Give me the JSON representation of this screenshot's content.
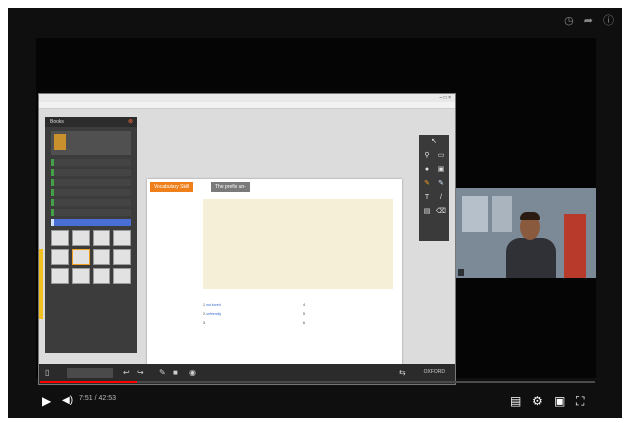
{
  "player": {
    "title": "",
    "top_icons": [
      "clock-icon",
      "share-icon",
      "info-icon"
    ],
    "progress": 0.175,
    "time": "7:51 / 42:53",
    "colors": {
      "progress": "#ff0000",
      "background": "#0f0f0f"
    }
  },
  "window": {
    "title": "",
    "menu": "",
    "controls": "–  □  ×"
  },
  "sidebar": {
    "header": "Books",
    "book_title": "",
    "units": [
      "",
      "",
      "",
      "",
      "",
      "",
      ""
    ],
    "selected_unit": 6
  },
  "page": {
    "section_tag": "Vocabulary Skill",
    "section_title": "The prefix un-",
    "info_lines": [],
    "exercise": "",
    "answers": [
      {
        "num": "1",
        "word": "",
        "fill": "not bored"
      },
      {
        "num": "4",
        "word": "",
        "fill": ""
      },
      {
        "num": "2",
        "word": "",
        "fill": "unfriendly"
      },
      {
        "num": "5",
        "word": "",
        "fill": ""
      },
      {
        "num": "3",
        "word": "",
        "fill": ""
      },
      {
        "num": "6",
        "word": "",
        "fill": ""
      }
    ]
  },
  "bottom_bar": {
    "pager": "",
    "publisher": "OXFORD"
  },
  "webcam": {
    "label": ""
  }
}
